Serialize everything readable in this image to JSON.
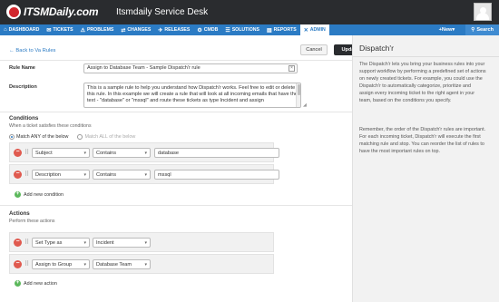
{
  "header": {
    "logo_text": "ITSMDaily.com",
    "app_title": "Itsmdaily Service Desk"
  },
  "nav": {
    "items": [
      {
        "icon": "⌂",
        "icon_name": "dashboard-icon",
        "label": "DASHBOARD"
      },
      {
        "icon": "✉",
        "icon_name": "tickets-icon",
        "label": "TICKETS"
      },
      {
        "icon": "⚠",
        "icon_name": "problems-icon",
        "label": "PROBLEMS"
      },
      {
        "icon": "⇄",
        "icon_name": "changes-icon",
        "label": "CHANGES"
      },
      {
        "icon": "✈",
        "icon_name": "releases-icon",
        "label": "RELEASES"
      },
      {
        "icon": "⚙",
        "icon_name": "cmdb-icon",
        "label": "CMDB"
      },
      {
        "icon": "☰",
        "icon_name": "solutions-icon",
        "label": "SOLUTIONS"
      },
      {
        "icon": "▤",
        "icon_name": "reports-icon",
        "label": "REPORTS"
      },
      {
        "icon": "✕",
        "icon_name": "admin-icon",
        "label": "ADMIN"
      }
    ],
    "new_label": "+New▾",
    "search_label": "Search"
  },
  "toolbar": {
    "back_label": "← Back to Va Rules",
    "cancel_label": "Cancel",
    "update_label": "Update"
  },
  "form": {
    "rule_name_label": "Rule Name",
    "rule_name_value": "Assign to Database Team - Sample Dispatch'r rule",
    "description_label": "Description",
    "description_value": "This is a sample rule to help you understand how Dispatch'r works. Feel free to edit or delete this rule. In this example we will create a rule that will look at all incoming emails that have the text - \"database\" or \"mssql\" and route these tickets as type Incident and assign"
  },
  "conditions": {
    "title": "Conditions",
    "subtitle": "When a ticket satisfies these conditions",
    "match_any_label": "Match ANY of the below",
    "match_all_label": "Match ALL of the below",
    "rows": [
      {
        "field": "Subject",
        "operator": "Contains",
        "value": "database"
      },
      {
        "field": "Description",
        "operator": "Contains",
        "value": "mssql"
      }
    ],
    "add_label": "Add new condition"
  },
  "actions": {
    "title": "Actions",
    "subtitle": "Perform these actions",
    "rows": [
      {
        "action": "Set Type as",
        "value": "Incident"
      },
      {
        "action": "Assign to Group",
        "value": "Database Team"
      }
    ],
    "add_label": "Add new action"
  },
  "sidebar": {
    "title": "Dispatch'r",
    "para1": "The Dispatch'r lets you bring your business rules into your support workflow by performing a predefined set of actions on newly created tickets. For example, you could use the Dispatch'r to automatically categorize, prioritize and assign every incoming ticket to the right agent in your team, based on the conditions you specify.",
    "para2": "Remember, the order of the Dispatch'r rules are important. For each incoming ticket, Dispatch'r will execute the first matching rule and stop. You can reorder the list of rules to have the most important rules on top."
  },
  "colors": {
    "header_bg": "#2a2c2f",
    "nav_bg": "#2b7bc4",
    "link": "#2b7bc4",
    "remove": "#e05a4f",
    "add": "#5cb85c"
  }
}
